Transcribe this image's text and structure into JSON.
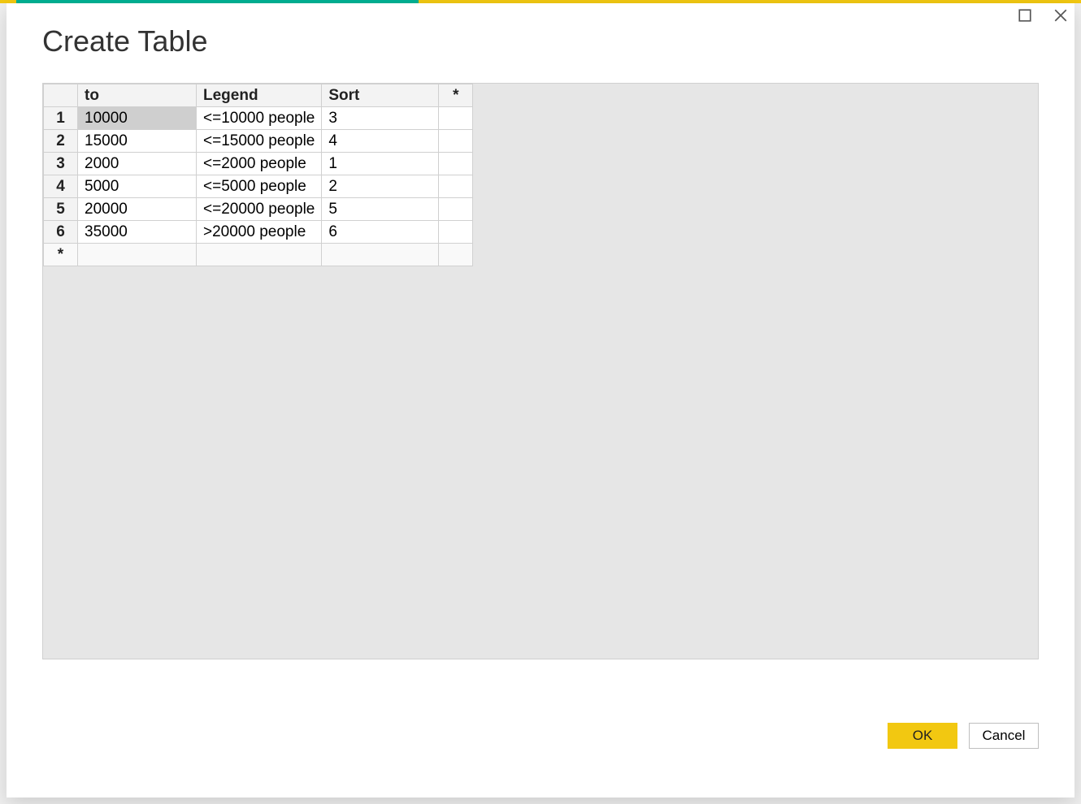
{
  "dialog": {
    "title": "Create Table"
  },
  "window": {
    "maximize_tooltip": "Maximize",
    "close_tooltip": "Close"
  },
  "table": {
    "headers": {
      "row_header": "",
      "to": "to",
      "legend": "Legend",
      "sort": "Sort",
      "star": "*"
    },
    "rows": [
      {
        "n": "1",
        "to": "10000",
        "legend": "<=10000 people",
        "sort": "3",
        "star": ""
      },
      {
        "n": "2",
        "to": "15000",
        "legend": "<=15000 people",
        "sort": "4",
        "star": ""
      },
      {
        "n": "3",
        "to": "2000",
        "legend": "<=2000 people",
        "sort": "1",
        "star": ""
      },
      {
        "n": "4",
        "to": "5000",
        "legend": "<=5000 people",
        "sort": "2",
        "star": ""
      },
      {
        "n": "5",
        "to": "20000",
        "legend": "<=20000 people",
        "sort": "5",
        "star": ""
      },
      {
        "n": "6",
        "to": "35000",
        "legend": ">20000 people",
        "sort": "6",
        "star": ""
      }
    ],
    "new_row_marker": "*",
    "selected_cell": {
      "row": 0,
      "col": "to"
    }
  },
  "buttons": {
    "ok": "OK",
    "cancel": "Cancel"
  }
}
